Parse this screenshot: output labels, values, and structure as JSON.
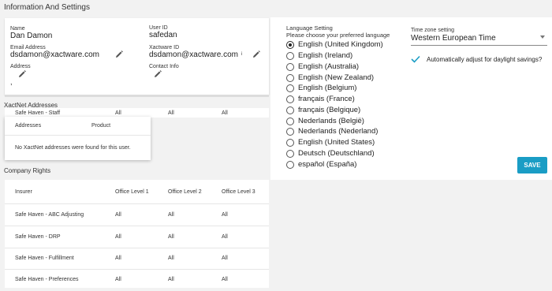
{
  "page": {
    "title": "Information And Settings"
  },
  "user_info": {
    "name_label": "Name",
    "name_value": "Dan Damon",
    "user_id_label": "User ID",
    "user_id_value": "safedan",
    "email_label": "Email Address",
    "email_value": "dsdamon@xactware.com",
    "xactware_id_label": "Xactware ID",
    "xactware_id_value": "dsdamon@xactware.com",
    "info_marker": "i",
    "address_label": "Address",
    "address_value": ",",
    "contact_info_label": "Contact Info"
  },
  "language": {
    "title": "Language Setting",
    "subtitle": "Please choose your preferred language",
    "options": [
      {
        "label": "English (United Kingdom)",
        "selected": true
      },
      {
        "label": "English (Ireland)",
        "selected": false
      },
      {
        "label": "English (Australia)",
        "selected": false
      },
      {
        "label": "English (New Zealand)",
        "selected": false
      },
      {
        "label": "English (Belgium)",
        "selected": false
      },
      {
        "label": "français (France)",
        "selected": false
      },
      {
        "label": "français (Belgique)",
        "selected": false
      },
      {
        "label": "Nederlands (België)",
        "selected": false
      },
      {
        "label": "Nederlands (Nederland)",
        "selected": false
      },
      {
        "label": "English (United States)",
        "selected": false
      },
      {
        "label": "Deutsch (Deutschland)",
        "selected": false
      },
      {
        "label": "español (España)",
        "selected": false
      }
    ]
  },
  "timezone": {
    "label": "Time zone setting",
    "value": "Western European Time",
    "dst_label": "Automatically adjust for daylight savings?",
    "dst_checked": true
  },
  "save_label": "SAVE",
  "xactnet": {
    "title": "XactNet Addresses",
    "partial_row": {
      "insurer": "Safe Haven - Staff",
      "l1": "All",
      "l2": "All",
      "l3": "All"
    },
    "popup": {
      "col_addresses": "Addresses",
      "col_product": "Product",
      "empty_message": "No XactNet addresses were found for this user."
    }
  },
  "company_rights": {
    "title": "Company Rights",
    "headers": [
      "Insurer",
      "Office Level 1",
      "Office Level 2",
      "Office Level 3"
    ],
    "rows": [
      {
        "insurer": "Safe Haven - ABC Adjusting",
        "l1": "All",
        "l2": "All",
        "l3": "All"
      },
      {
        "insurer": "Safe Haven - DRP",
        "l1": "All",
        "l2": "All",
        "l3": "All"
      },
      {
        "insurer": "Safe Haven - Fulfillment",
        "l1": "All",
        "l2": "All",
        "l3": "All"
      },
      {
        "insurer": "Safe Haven - Preferences",
        "l1": "All",
        "l2": "All",
        "l3": "All"
      }
    ]
  },
  "colors": {
    "accent": "#1a9dc5",
    "background": "#f2f2f2",
    "card": "#ffffff"
  }
}
